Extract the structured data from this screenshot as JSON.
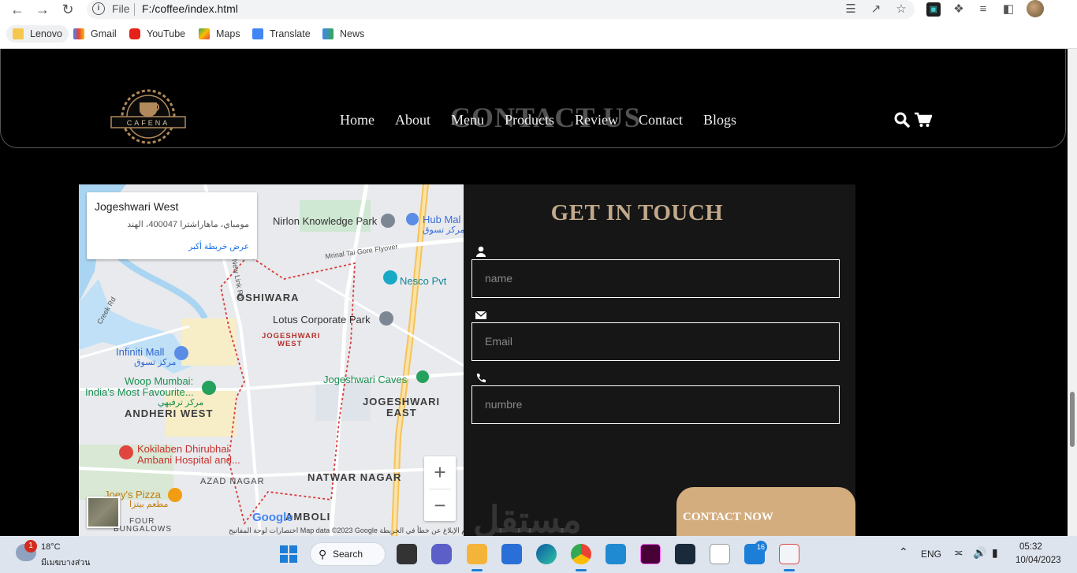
{
  "browser": {
    "file_label": "File",
    "url": "F:/coffee/index.html",
    "bookmarks": [
      "Lenovo",
      "Gmail",
      "YouTube",
      "Maps",
      "Translate",
      "News"
    ]
  },
  "header": {
    "logo_text": "CAFENA",
    "nav": [
      "Home",
      "About",
      "Menu",
      "Products",
      "Review",
      "Contact",
      "Blogs"
    ],
    "ghost_title": "CONTACT US"
  },
  "map": {
    "card_title": "Jogeshwari West",
    "card_address": "مومباي، ماهاراشترا 400047، الهند",
    "card_link": "عرض خريطة أكبر",
    "labels": {
      "nirlon": "Nirlon Knowledge Park",
      "hub": "Hub Mal",
      "hub_ar": "مركز تسوق",
      "flyover": "Mrinal Tai Gore Flyover",
      "nesco": "Nesco Pvt",
      "link_road": "New Link Rd",
      "oshiwara": "OSHIWARA",
      "creek": "Creek Rd",
      "lotus": "Lotus Corporate Park",
      "jw1": "JOGESHWARI",
      "jw2": "WEST",
      "infiniti": "Infiniti Mall",
      "infiniti_ar": "مركز تسوق",
      "caves": "Jogeshwari Caves",
      "woop1": "Woop Mumbai:",
      "woop2": "India's Most Favourite...",
      "woop_ar": "مركز ترفيهي",
      "andheri": "ANDHERI WEST",
      "je1": "JOGESHWARI",
      "je2": "EAST",
      "koki1": "Kokilaben Dhirubhai",
      "koki2": "Ambani Hospital and...",
      "azad": "AZAD NAGAR",
      "natwar": "NATWAR NAGAR",
      "joey": "Joey's Pizza",
      "joey_ar": "مطعم بيتزا",
      "four": "FOUR",
      "bungalows": "BUNGALOWS",
      "amboli": "AMBOLI"
    },
    "google": "Google",
    "footer": "اختصارات لوحة المفاتيح   Map data ©2023 Google   شروط الاستخدام   الإبلاغ عن خطأ في الخريطة",
    "zoom_in": "+",
    "zoom_out": "−"
  },
  "form": {
    "title": "GET IN TOUCH",
    "name_placeholder": "name",
    "email_placeholder": "Email",
    "number_placeholder": "numbre",
    "submit": "CONTACT NOW"
  },
  "watermark": "مستقل",
  "taskbar": {
    "weather_badge": "1",
    "temp": "18°C",
    "weather_status": "มีเมฆบางส่วน",
    "search_label": "Search",
    "notif_count": "16",
    "lang": "ENG",
    "time": "05:32",
    "date": "10/04/2023"
  }
}
